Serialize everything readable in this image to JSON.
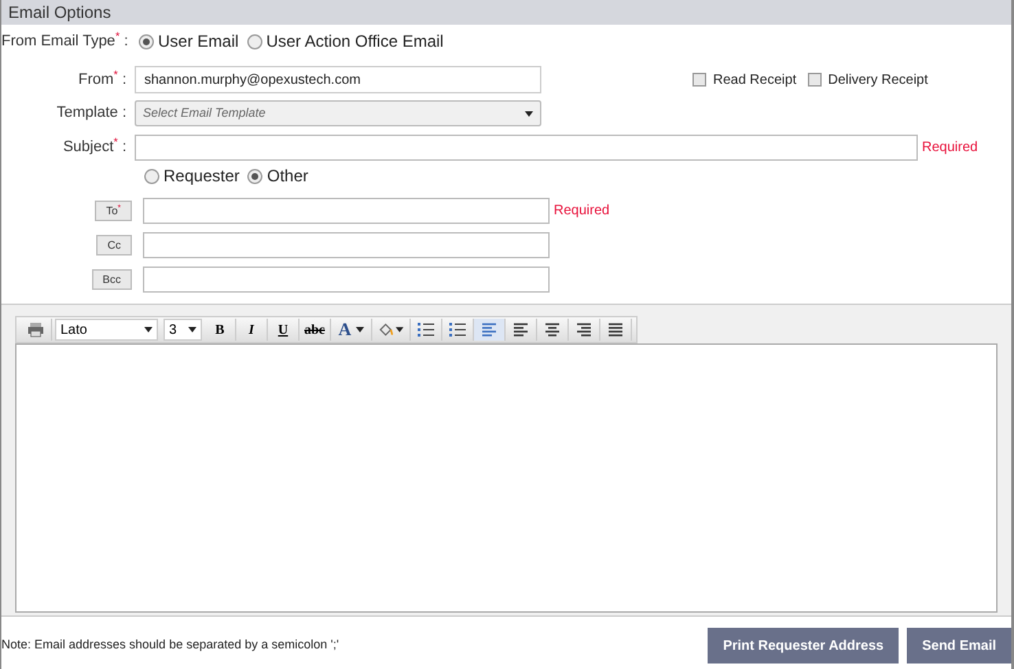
{
  "section_title": "Email Options",
  "label_suffix": ":",
  "from_type": {
    "label": "From Email Type",
    "required_mark": "*",
    "options": [
      {
        "label": "User Email",
        "selected": true
      },
      {
        "label": "User Action Office Email",
        "selected": false
      }
    ]
  },
  "from": {
    "label": "From",
    "required_mark": "*",
    "value": "shannon.murphy@opexustech.com"
  },
  "receipts": [
    {
      "label": "Read Receipt",
      "checked": false
    },
    {
      "label": "Delivery Receipt",
      "checked": false
    }
  ],
  "template": {
    "label": "Template",
    "placeholder": "Select Email Template"
  },
  "subject": {
    "label": "Subject",
    "required_mark": "*",
    "hint": "Required"
  },
  "recipient_type": [
    {
      "label": "Requester",
      "selected": false
    },
    {
      "label": "Other",
      "selected": true
    }
  ],
  "recipients": [
    {
      "label": "To",
      "required_mark": "*",
      "hint": "Required"
    },
    {
      "label": "Cc"
    },
    {
      "label": "Bcc"
    }
  ],
  "toolbar": [
    {
      "kind": "print"
    },
    {
      "kind": "font",
      "value": "Lato"
    },
    {
      "kind": "size",
      "value": "3"
    },
    {
      "kind": "bold",
      "value": "B"
    },
    {
      "kind": "italic",
      "value": "I"
    },
    {
      "kind": "underline",
      "value": "U"
    },
    {
      "kind": "strike",
      "value": "abc"
    },
    {
      "kind": "color",
      "value": "A"
    },
    {
      "kind": "fill"
    },
    {
      "kind": "bullets"
    },
    {
      "kind": "numbers"
    },
    {
      "kind": "left",
      "selected": true
    },
    {
      "kind": "left",
      "selected": false
    },
    {
      "kind": "center",
      "selected": false
    },
    {
      "kind": "right",
      "selected": false
    },
    {
      "kind": "justify",
      "selected": false
    }
  ],
  "note": "Note: Email addresses should be separated by a semicolon ';'",
  "buttons": [
    "Print Requester Address",
    "Send Email"
  ]
}
